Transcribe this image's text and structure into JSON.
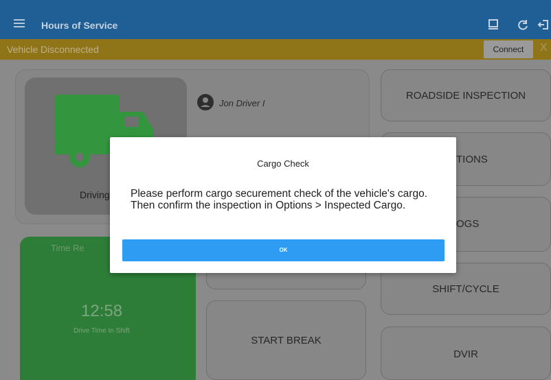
{
  "app_bar": {
    "title": "Hours of Service",
    "icons": [
      "menu-icon",
      "hos-document-icon",
      "refresh-icon",
      "logout-icon"
    ]
  },
  "banner": {
    "text": "Vehicle Disconnected",
    "connect_label": "Connect",
    "close_label": "X"
  },
  "status": {
    "driver_name": "Jon Driver I",
    "duty_status": "Driving",
    "time_remaining_label": "Time Re",
    "clock": "12:58",
    "clock_caption": "Drive Time In Shift"
  },
  "actions": {
    "roadside_inspection": "ROADSIDE INSPECTION",
    "options_partial": "TIONS",
    "logs_partial": "OGS",
    "shift_cycle": "SHIFT/CYCLE",
    "start_break": "START BREAK",
    "dvir": "DVIR"
  },
  "dialog": {
    "title": "Cargo Check",
    "message": "Please perform cargo securement check of the vehicle's cargo. Then confirm the inspection in Options > Inspected Cargo.",
    "ok_label": "OK"
  },
  "colors": {
    "appbar": "#1f5f95",
    "banner": "#8f7418",
    "driving_green": "#2d7d38",
    "ok_button": "#2f9cf3"
  }
}
